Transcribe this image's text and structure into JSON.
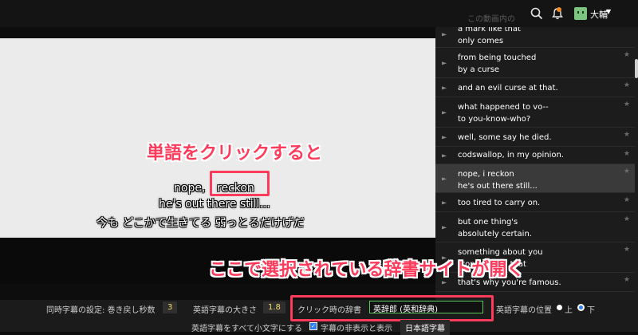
{
  "header": {
    "ghost_text": "この動画内の",
    "username": "大輔"
  },
  "video": {
    "annotation_top": "単語をクリックすると",
    "subtitle_line1_prefix": "nope,",
    "subtitle_word": "reckon",
    "subtitle_line2": "he's out there still...",
    "subtitle_ja": "今も どこかで生きてる 弱っとるだけげだ"
  },
  "transcript": {
    "rows": [
      {
        "text": "a mark like that\nonly comes",
        "active": false
      },
      {
        "text": "from being touched\nby a curse",
        "active": false
      },
      {
        "text": "and an evil curse at that.",
        "active": false
      },
      {
        "text": "what happened to vo--\nto you-know-who?",
        "active": false
      },
      {
        "text": "well, some say he died.",
        "active": false
      },
      {
        "text": "codswallop, in my opinion.",
        "active": false
      },
      {
        "text": "nope, i reckon\nhe's out there still...",
        "active": true
      },
      {
        "text": "too tired to carry on.",
        "active": false
      },
      {
        "text": "but one thing's\nabsolutely certain.",
        "active": false
      },
      {
        "text": "something about you\nstopped him that",
        "active": false
      },
      {
        "text": "that's why you're famous.",
        "active": false
      }
    ]
  },
  "annotation_bottom": "ここで選択されている辞書サイトが開く",
  "settings": {
    "rewind_label": "同時字幕の設定: 巻き戻し秒数",
    "rewind_value": "3",
    "size_label": "英語字幕の大きさ",
    "size_value": "1.8",
    "dict_label": "クリック時の辞書",
    "dict_value": "英辞郎 (英和辞典)",
    "position_label": "英語字幕の位置",
    "pos_top": "上",
    "pos_bottom": "下",
    "lowercase_label": "英語字幕をすべて小文字にする",
    "toggle_label": "字幕の非表示と表示",
    "ja_sub_label": "日本語字幕"
  },
  "colors": {
    "accent": "#ff3b5c",
    "value": "#f5d96b",
    "input_border": "#59c859"
  }
}
